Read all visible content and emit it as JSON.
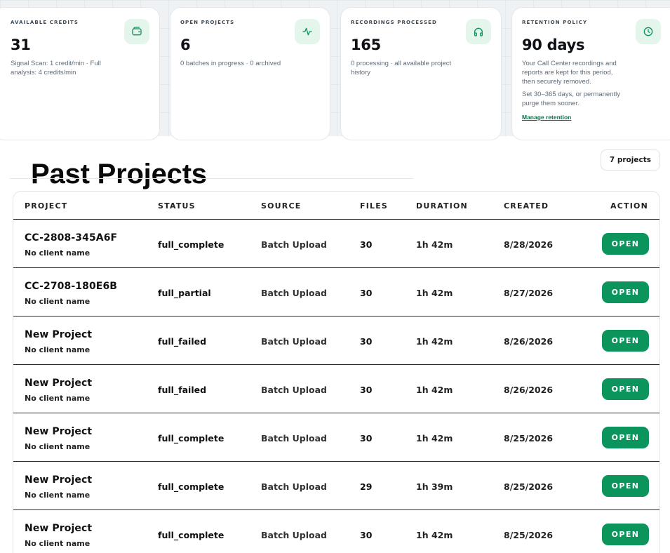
{
  "stats": {
    "credits": {
      "label": "AVAILABLE CREDITS",
      "value": "31",
      "sub": "Signal Scan: 1 credit/min · Full analysis: 4 credits/min",
      "icon": "wallet-icon"
    },
    "projects": {
      "label": "OPEN PROJECTS",
      "value": "6",
      "sub": "0 batches in progress · 0 archived",
      "icon": "activity-icon"
    },
    "recordings": {
      "label": "RECORDINGS PROCESSED",
      "value": "165",
      "sub": "0 processing · all available project history",
      "icon": "headphones-icon"
    },
    "retention": {
      "label": "RETENTION POLICY",
      "value": "90 days",
      "sub1": "Your Call Center recordings and reports are kept for this period, then securely removed.",
      "sub2": "Set 30–365 days, or permanently purge them sooner.",
      "link": "Manage retention",
      "icon": "clock-icon"
    }
  },
  "section": {
    "title": "Past Projects",
    "count_badge": "7 projects"
  },
  "table": {
    "headers": {
      "project": "PROJECT",
      "status": "STATUS",
      "source": "SOURCE",
      "files": "FILES",
      "duration": "DURATION",
      "created": "CREATED",
      "action": "ACTION"
    },
    "rows": [
      {
        "project": "CC-2808-345A6F",
        "client": "No client name",
        "status": "full_complete",
        "source": "Batch Upload",
        "files": "30",
        "duration": "1h 42m",
        "created": "8/28/2026",
        "action": "OPEN"
      },
      {
        "project": "CC-2708-180E6B",
        "client": "No client name",
        "status": "full_partial",
        "source": "Batch Upload",
        "files": "30",
        "duration": "1h 42m",
        "created": "8/27/2026",
        "action": "OPEN"
      },
      {
        "project": "New Project",
        "client": "No client name",
        "status": "full_failed",
        "source": "Batch Upload",
        "files": "30",
        "duration": "1h 42m",
        "created": "8/26/2026",
        "action": "OPEN"
      },
      {
        "project": "New Project",
        "client": "No client name",
        "status": "full_failed",
        "source": "Batch Upload",
        "files": "30",
        "duration": "1h 42m",
        "created": "8/26/2026",
        "action": "OPEN"
      },
      {
        "project": "New Project",
        "client": "No client name",
        "status": "full_complete",
        "source": "Batch Upload",
        "files": "30",
        "duration": "1h 42m",
        "created": "8/25/2026",
        "action": "OPEN"
      },
      {
        "project": "New Project",
        "client": "No client name",
        "status": "full_complete",
        "source": "Batch Upload",
        "files": "29",
        "duration": "1h 39m",
        "created": "8/25/2026",
        "action": "OPEN"
      },
      {
        "project": "New Project",
        "client": "No client name",
        "status": "full_complete",
        "source": "Batch Upload",
        "files": "30",
        "duration": "1h 42m",
        "created": "8/25/2026",
        "action": "OPEN"
      }
    ]
  },
  "colors": {
    "accent": "#0b945c",
    "icon_bg": "#e4f6ec",
    "link": "#0e6e47"
  }
}
